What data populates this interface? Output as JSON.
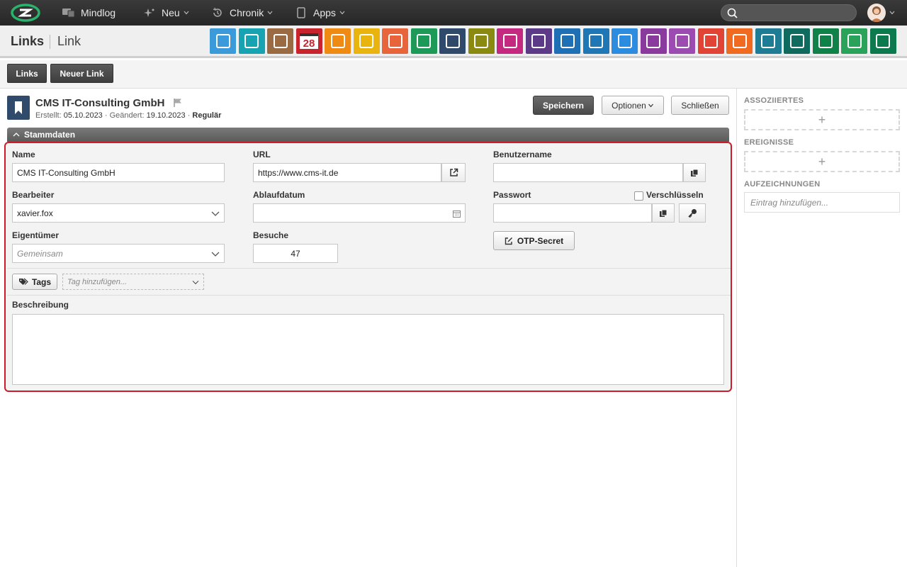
{
  "topbar": {
    "nav": [
      {
        "label": "Mindlog",
        "icon": "devices-icon"
      },
      {
        "label": "Neu",
        "icon": "sparkle-icon"
      },
      {
        "label": "Chronik",
        "icon": "history-icon"
      },
      {
        "label": "Apps",
        "icon": "tablet-icon"
      }
    ],
    "search_placeholder": ""
  },
  "titlebar": {
    "module": "Links",
    "entity": "Link",
    "apps": [
      {
        "name": "mail",
        "color": "#3b9ad9"
      },
      {
        "name": "address-book",
        "color": "#18a3b3"
      },
      {
        "name": "contacts",
        "color": "#9a6b43"
      },
      {
        "name": "calendar",
        "color": "#c9232e",
        "text": "28"
      },
      {
        "name": "timer",
        "color": "#ef8a12"
      },
      {
        "name": "tasks",
        "color": "#e8b40d"
      },
      {
        "name": "projects",
        "color": "#e8643a"
      },
      {
        "name": "notes",
        "color": "#1d9a57"
      },
      {
        "name": "links",
        "color": "#2f4a6b"
      },
      {
        "name": "documents",
        "color": "#8a8a10"
      },
      {
        "name": "sales",
        "color": "#c5297f"
      },
      {
        "name": "billing",
        "color": "#5d3a87"
      },
      {
        "name": "delivery",
        "color": "#1f6fb5"
      },
      {
        "name": "support",
        "color": "#2077b5"
      },
      {
        "name": "money-bag",
        "color": "#2c8ce0"
      },
      {
        "name": "contracts",
        "color": "#8a3a9c"
      },
      {
        "name": "partners",
        "color": "#9c4bb0"
      },
      {
        "name": "pdf",
        "color": "#e14434"
      },
      {
        "name": "broadcast",
        "color": "#f06a1f"
      },
      {
        "name": "download",
        "color": "#1e7d94"
      },
      {
        "name": "shop",
        "color": "#0f6b5e"
      },
      {
        "name": "finance",
        "color": "#11814a"
      },
      {
        "name": "pricing",
        "color": "#29a35a"
      },
      {
        "name": "database",
        "color": "#0c7a4c"
      }
    ]
  },
  "subbar": {
    "links_label": "Links",
    "new_link_label": "Neuer Link"
  },
  "record": {
    "title": "CMS IT-Consulting GmbH",
    "created_label": "Erstellt:",
    "created": "05.10.2023",
    "changed_label": "Geändert:",
    "changed": "19.10.2023",
    "status": "Regulär",
    "save_label": "Speichern",
    "options_label": "Optionen",
    "close_label": "Schließen"
  },
  "section": {
    "title": "Stammdaten"
  },
  "form": {
    "name_label": "Name",
    "name_value": "CMS IT-Consulting GmbH",
    "url_label": "URL",
    "url_value": "https://www.cms-it.de",
    "username_label": "Benutzername",
    "username_value": "",
    "editor_label": "Bearbeiter",
    "editor_value": "xavier.fox",
    "expiry_label": "Ablaufdatum",
    "expiry_value": "",
    "password_label": "Passwort",
    "encrypt_label": "Verschlüsseln",
    "password_value": "",
    "owner_label": "Eigentümer",
    "owner_placeholder": "Gemeinsam",
    "visits_label": "Besuche",
    "visits_value": "47",
    "otp_label": "OTP-Secret",
    "tags_label": "Tags",
    "tags_placeholder": "Tag hinzufügen...",
    "description_label": "Beschreibung"
  },
  "sidebar": {
    "associated": "ASSOZIIERTES",
    "events": "EREIGNISSE",
    "records": "AUFZEICHNUNGEN",
    "records_placeholder": "Eintrag hinzufügen..."
  }
}
